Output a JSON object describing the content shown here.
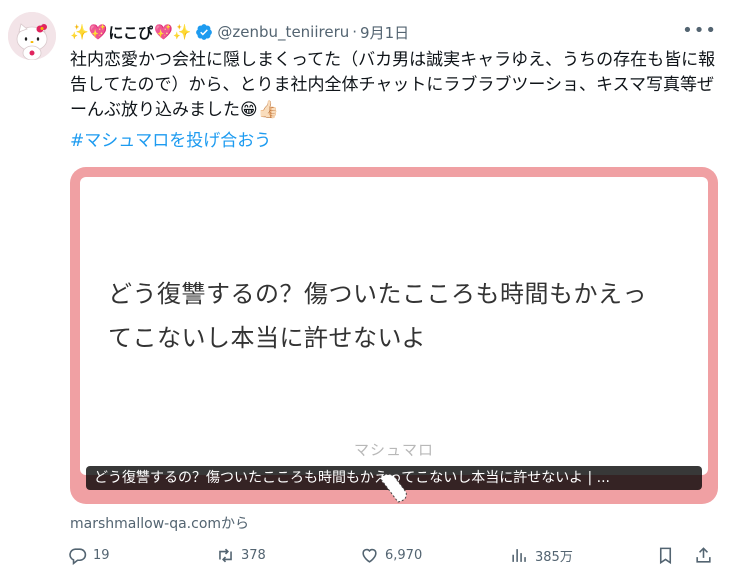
{
  "author": {
    "display_name_prefix": "✨💖",
    "display_name_core": "にこぴ",
    "display_name_suffix": "💖✨",
    "handle": "@zenbu_teniireru",
    "separator": "·",
    "date": "9月1日",
    "verified": true
  },
  "icons": {
    "avatar": "hello-kitty-avatar",
    "verified": "verified-badge-icon",
    "more": "more-dots-icon",
    "reply": "reply-icon",
    "retweet": "retweet-icon",
    "like": "heart-icon",
    "views": "views-bar-icon",
    "bookmark": "bookmark-icon",
    "share": "share-icon"
  },
  "tweet": {
    "text": "社内恋愛かつ会社に隠しまくってた（バカ男は誠実キャラゆえ、うちの存在も皆に報告してたので）から、とりま社内全体チャットにラブラブツーショ、キスマ写真等ぜーんぶ放り込みました",
    "text_emoji": "😁👍🏻",
    "hashtag": "#マシュマロを投げ合おう"
  },
  "card": {
    "question": "どう復讐するの？傷ついたこころも時間もかえってこないし本当に許せないよ",
    "brand": "マシュマロ",
    "caption": "どう復讐するの？傷ついたこころも時間もかえってこないし本当に許せないよ | ...",
    "source": "marshmallow-qa.comから",
    "border_color": "#f0a0a3"
  },
  "metrics": {
    "replies": "19",
    "retweets": "378",
    "likes": "6,970",
    "views": "385万"
  },
  "colors": {
    "accent": "#1d9bf0",
    "muted": "#536471",
    "text": "#0f1419"
  }
}
